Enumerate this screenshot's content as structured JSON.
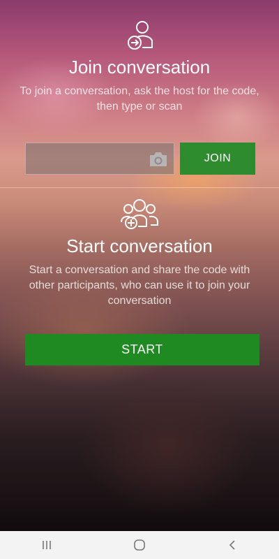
{
  "join": {
    "title": "Join conversation",
    "description": "To join a conversation, ask the host for the code, then type or scan",
    "code_input_value": "",
    "code_input_placeholder": "",
    "join_button_label": "JOIN",
    "icon": "person-join-icon",
    "scan_icon": "camera-icon"
  },
  "start": {
    "title": "Start conversation",
    "description": "Start a conversation and share the code with other participants, who can use it to join your conversation",
    "start_button_label": "START",
    "icon": "group-add-icon"
  },
  "navbar": {
    "items": [
      "recent-apps-icon",
      "home-icon",
      "back-icon"
    ]
  },
  "colors": {
    "button_green": "#2e8b2e",
    "start_green": "#1f8a22",
    "text_white": "#ffffff",
    "navbar_bg": "#f3f3f3"
  }
}
